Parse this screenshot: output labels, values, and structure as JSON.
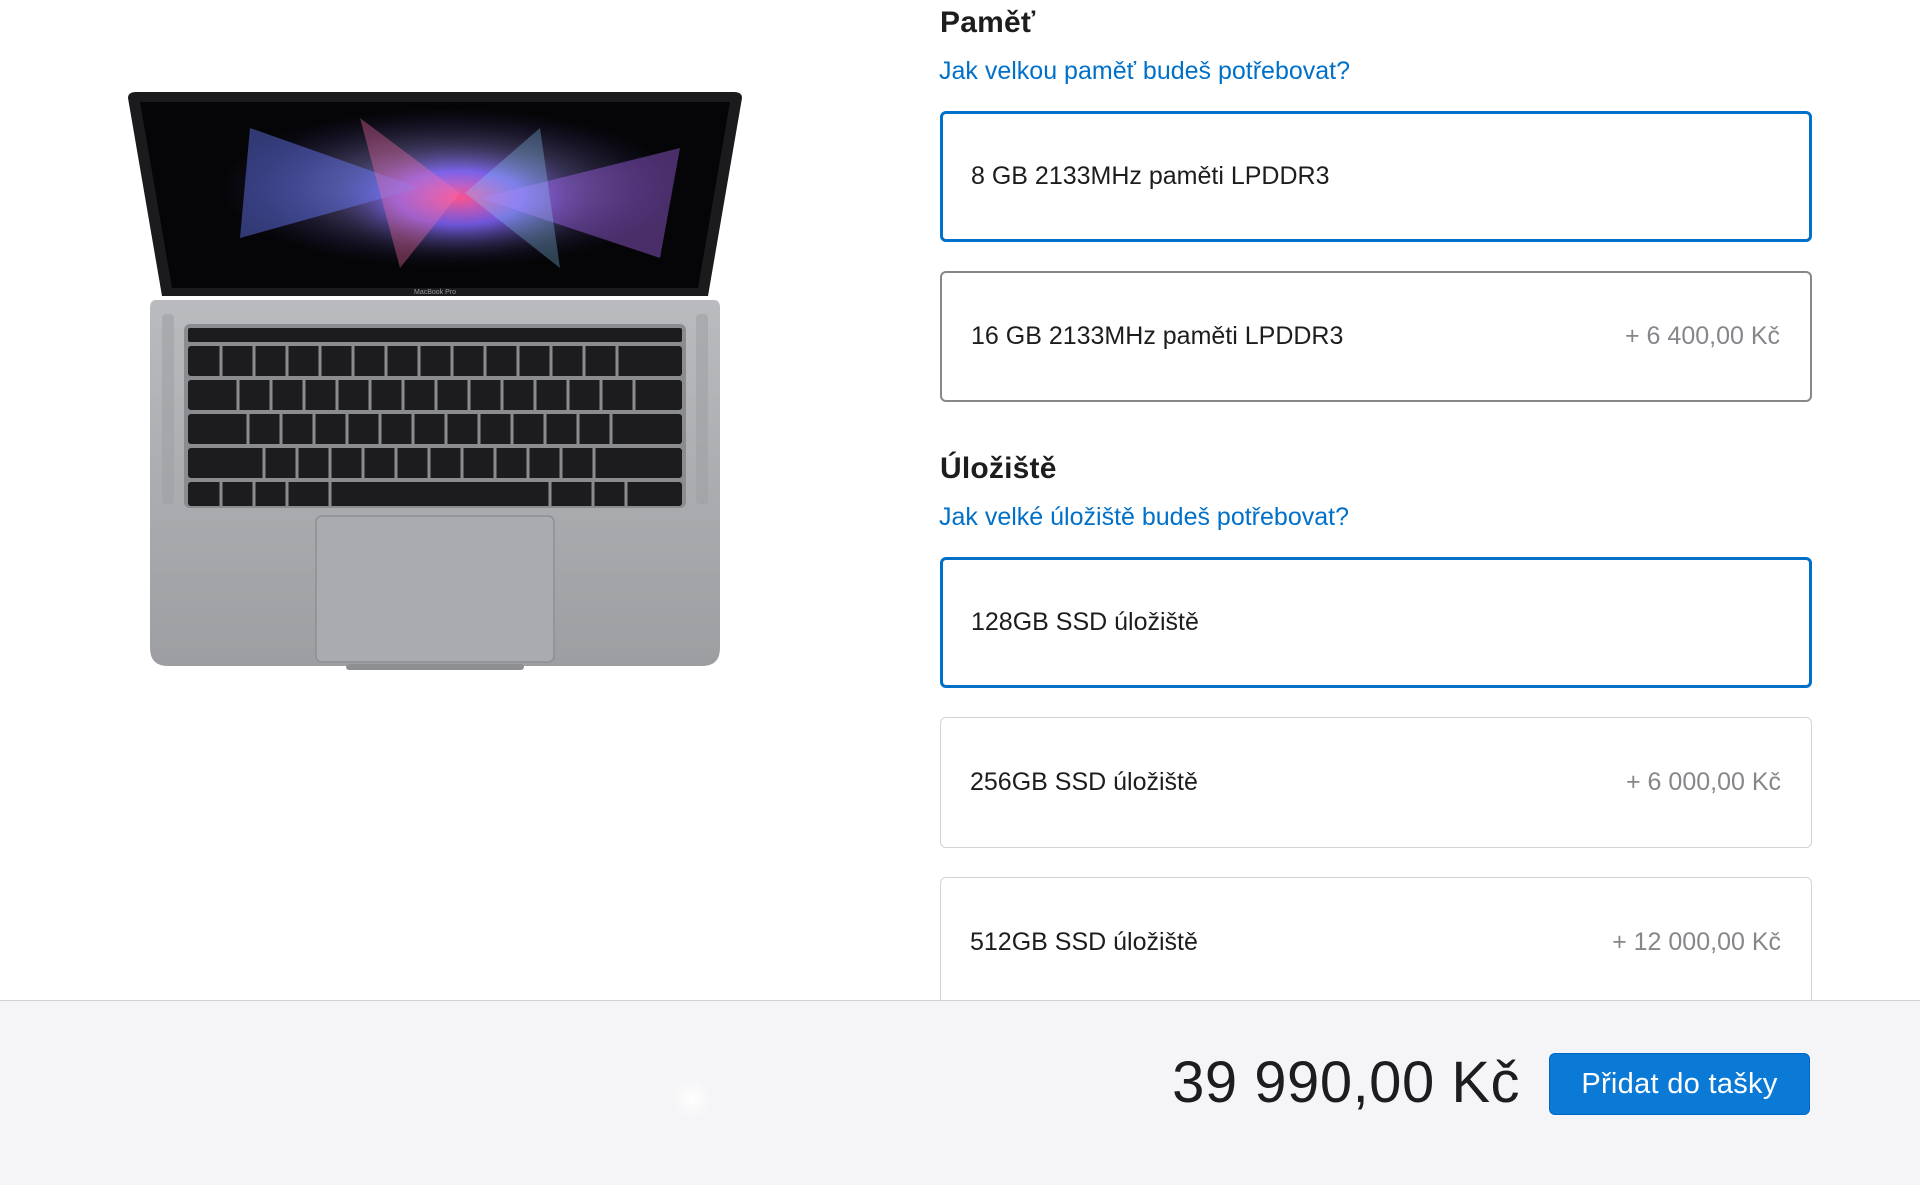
{
  "memory": {
    "title": "Paměť",
    "help_link": "Jak velkou paměť budeš potřebovat?",
    "options": [
      {
        "label": "8 GB 2133MHz paměti LPDDR3",
        "price": "",
        "selected": true
      },
      {
        "label": "16 GB 2133MHz paměti LPDDR3",
        "price": "+ 6 400,00 Kč",
        "selected": false
      }
    ]
  },
  "storage": {
    "title": "Úložiště",
    "help_link": "Jak velké úložiště budeš potřebovat?",
    "options": [
      {
        "label": "128GB SSD úložiště",
        "price": "",
        "selected": true
      },
      {
        "label": "256GB SSD úložiště",
        "price": "+ 6 000,00 Kč",
        "selected": false
      },
      {
        "label": "512GB SSD úložiště",
        "price": "+ 12 000,00 Kč",
        "selected": false
      }
    ]
  },
  "summary": {
    "total": "39 990,00 Kč",
    "add_to_bag_label": "Přidat do tašky"
  },
  "colors": {
    "accent": "#0071c9",
    "link": "#0070c9",
    "button": "#0a7ad6",
    "laptop_body": "#a7a9ac"
  },
  "product": {
    "screen_brand_label": "MacBook Pro",
    "image_icon": "laptop-image"
  }
}
